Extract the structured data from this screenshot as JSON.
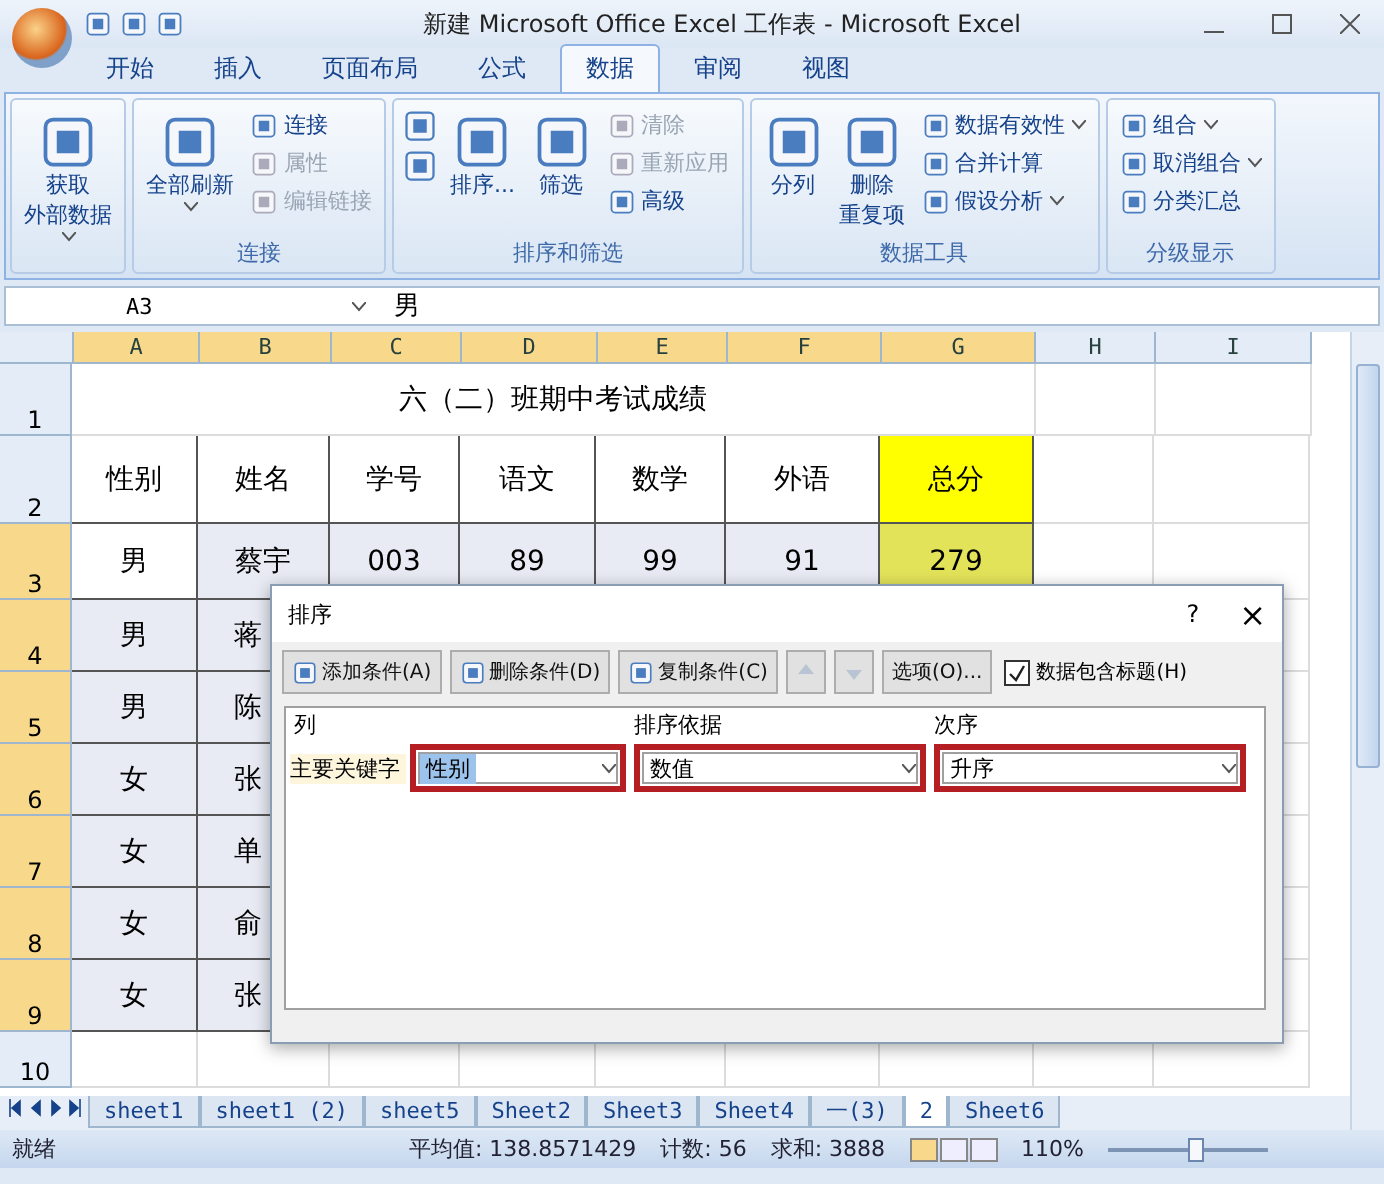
{
  "window": {
    "title": "新建 Microsoft Office Excel 工作表 - Microsoft Excel"
  },
  "ribbon_tabs": [
    {
      "label": "开始",
      "selected": false
    },
    {
      "label": "插入",
      "selected": false
    },
    {
      "label": "页面布局",
      "selected": false
    },
    {
      "label": "公式",
      "selected": false
    },
    {
      "label": "数据",
      "selected": true
    },
    {
      "label": "审阅",
      "selected": false
    },
    {
      "label": "视图",
      "selected": false
    }
  ],
  "ribbon_groups": [
    {
      "items": [
        {
          "lines": [
            "获取",
            "外部数据"
          ],
          "kind": "large",
          "dropdown": true,
          "disabled": false
        }
      ]
    },
    {
      "label": "连接",
      "items": [
        {
          "lines": [
            "全部刷新"
          ],
          "kind": "large",
          "dropdown": true,
          "disabled": false
        },
        {
          "label": "连接",
          "kind": "small",
          "dropdown": false,
          "disabled": false
        },
        {
          "label": "属性",
          "kind": "small",
          "dropdown": false,
          "disabled": true
        },
        {
          "label": "编辑链接",
          "kind": "small",
          "dropdown": false,
          "disabled": true
        }
      ]
    },
    {
      "label": "排序和筛选",
      "items": [
        {
          "kind": "sortpair"
        },
        {
          "lines": [
            "排序..."
          ],
          "kind": "large",
          "dropdown": false,
          "disabled": false
        },
        {
          "lines": [
            "筛选"
          ],
          "kind": "large",
          "dropdown": false,
          "disabled": false
        },
        {
          "label": "清除",
          "kind": "small",
          "dropdown": false,
          "disabled": true
        },
        {
          "label": "重新应用",
          "kind": "small",
          "dropdown": false,
          "disabled": true
        },
        {
          "label": "高级",
          "kind": "small",
          "dropdown": false,
          "disabled": false
        }
      ]
    },
    {
      "label": "数据工具",
      "items": [
        {
          "lines": [
            "分列"
          ],
          "kind": "large",
          "dropdown": false,
          "disabled": false
        },
        {
          "lines": [
            "删除",
            "重复项"
          ],
          "kind": "large",
          "dropdown": false,
          "disabled": false
        },
        {
          "label": "数据有效性",
          "kind": "small",
          "dropdown": true,
          "disabled": false
        },
        {
          "label": "合并计算",
          "kind": "small",
          "dropdown": false,
          "disabled": false
        },
        {
          "label": "假设分析",
          "kind": "small",
          "dropdown": true,
          "disabled": false
        }
      ]
    },
    {
      "label": "分级显示",
      "items": [
        {
          "label": "组合",
          "kind": "small",
          "dropdown": true,
          "disabled": false
        },
        {
          "label": "取消组合",
          "kind": "small",
          "dropdown": true,
          "disabled": false
        },
        {
          "label": "分类汇总",
          "kind": "small",
          "dropdown": false,
          "disabled": false
        }
      ]
    }
  ],
  "formula_bar": {
    "name_box": "A3",
    "formula": "男"
  },
  "sheet": {
    "columns": [
      {
        "label": "A",
        "selected": true
      },
      {
        "label": "B",
        "selected": true
      },
      {
        "label": "C",
        "selected": true
      },
      {
        "label": "D",
        "selected": true
      },
      {
        "label": "E",
        "selected": true
      },
      {
        "label": "F",
        "selected": true
      },
      {
        "label": "G",
        "selected": true
      },
      {
        "label": "H",
        "selected": false
      },
      {
        "label": "I",
        "selected": false
      }
    ],
    "rows": [
      {
        "number": "1",
        "selected": false,
        "title": "六（二）班期中考试成绩",
        "cells": []
      },
      {
        "number": "2",
        "selected": false,
        "cells": [
          {
            "text": "性别",
            "highlighted": false
          },
          {
            "text": "姓名",
            "highlighted": false
          },
          {
            "text": "学号",
            "highlighted": false
          },
          {
            "text": "语文",
            "highlighted": false
          },
          {
            "text": "数学",
            "highlighted": false
          },
          {
            "text": "外语",
            "highlighted": false
          },
          {
            "text": "总分",
            "highlighted": true
          }
        ]
      },
      {
        "number": "3",
        "selected": true,
        "cells": [
          {
            "text": "男",
            "highlighted": false
          },
          {
            "text": "蔡宇",
            "highlighted": false
          },
          {
            "text": "003",
            "highlighted": false
          },
          {
            "text": "89",
            "highlighted": false
          },
          {
            "text": "99",
            "highlighted": false
          },
          {
            "text": "91",
            "highlighted": false
          },
          {
            "text": "279",
            "highlighted": true
          }
        ]
      },
      {
        "number": "4",
        "selected": true,
        "cells": [
          {
            "text": "男",
            "highlighted": false
          },
          {
            "text": "蒋",
            "highlighted": false
          }
        ]
      },
      {
        "number": "5",
        "selected": true,
        "cells": [
          {
            "text": "男",
            "highlighted": false
          },
          {
            "text": "陈",
            "highlighted": false
          }
        ]
      },
      {
        "number": "6",
        "selected": true,
        "cells": [
          {
            "text": "女",
            "highlighted": false
          },
          {
            "text": "张",
            "highlighted": false
          }
        ]
      },
      {
        "number": "7",
        "selected": true,
        "cells": [
          {
            "text": "女",
            "highlighted": false
          },
          {
            "text": "单",
            "highlighted": false
          }
        ]
      },
      {
        "number": "8",
        "selected": true,
        "cells": [
          {
            "text": "女",
            "highlighted": false
          },
          {
            "text": "俞",
            "highlighted": false
          }
        ]
      },
      {
        "number": "9",
        "selected": true,
        "cells": [
          {
            "text": "女",
            "highlighted": false
          },
          {
            "text": "张",
            "highlighted": false
          }
        ]
      },
      {
        "number": "10",
        "selected": false,
        "cells": []
      }
    ]
  },
  "sheet_tabs": [
    {
      "label": "sheet1",
      "selected": false
    },
    {
      "label": "sheet1 (2)",
      "selected": false
    },
    {
      "label": "sheet5",
      "selected": false
    },
    {
      "label": "Sheet2",
      "selected": false
    },
    {
      "label": "Sheet3",
      "selected": false
    },
    {
      "label": "Sheet4",
      "selected": false
    },
    {
      "label": "一(3)",
      "selected": false
    },
    {
      "label": "2",
      "selected": true
    },
    {
      "label": "Sheet6",
      "selected": false
    }
  ],
  "status_bar": {
    "state": "就绪",
    "average": "平均值: 138.8571429",
    "count": "计数: 56",
    "sum": "求和: 3888",
    "zoom": "110%",
    "zoom_slider": {
      "level": 0.55
    }
  },
  "sort_dialog": {
    "title": "排序",
    "help": "?",
    "close": "×",
    "toolbar": [
      {
        "kind": "add",
        "label": "添加条件(A)",
        "disabled": false
      },
      {
        "kind": "delete",
        "label": "删除条件(D)",
        "disabled": false
      },
      {
        "kind": "copy",
        "label": "复制条件(C)",
        "disabled": false
      },
      {
        "kind": "up",
        "disabled": true
      },
      {
        "kind": "down",
        "disabled": true
      },
      {
        "kind": "options",
        "label": "选项(O)...",
        "disabled": false
      }
    ],
    "header_checkbox": {
      "label": "数据包含标题(H)",
      "checked": true
    },
    "headers": [
      "列",
      "排序依据",
      "次序"
    ],
    "levels": [
      {
        "label": "主要关键字",
        "column": "性别",
        "sort_on": "数值",
        "order": "升序",
        "selected": true,
        "outlined": true
      }
    ]
  }
}
